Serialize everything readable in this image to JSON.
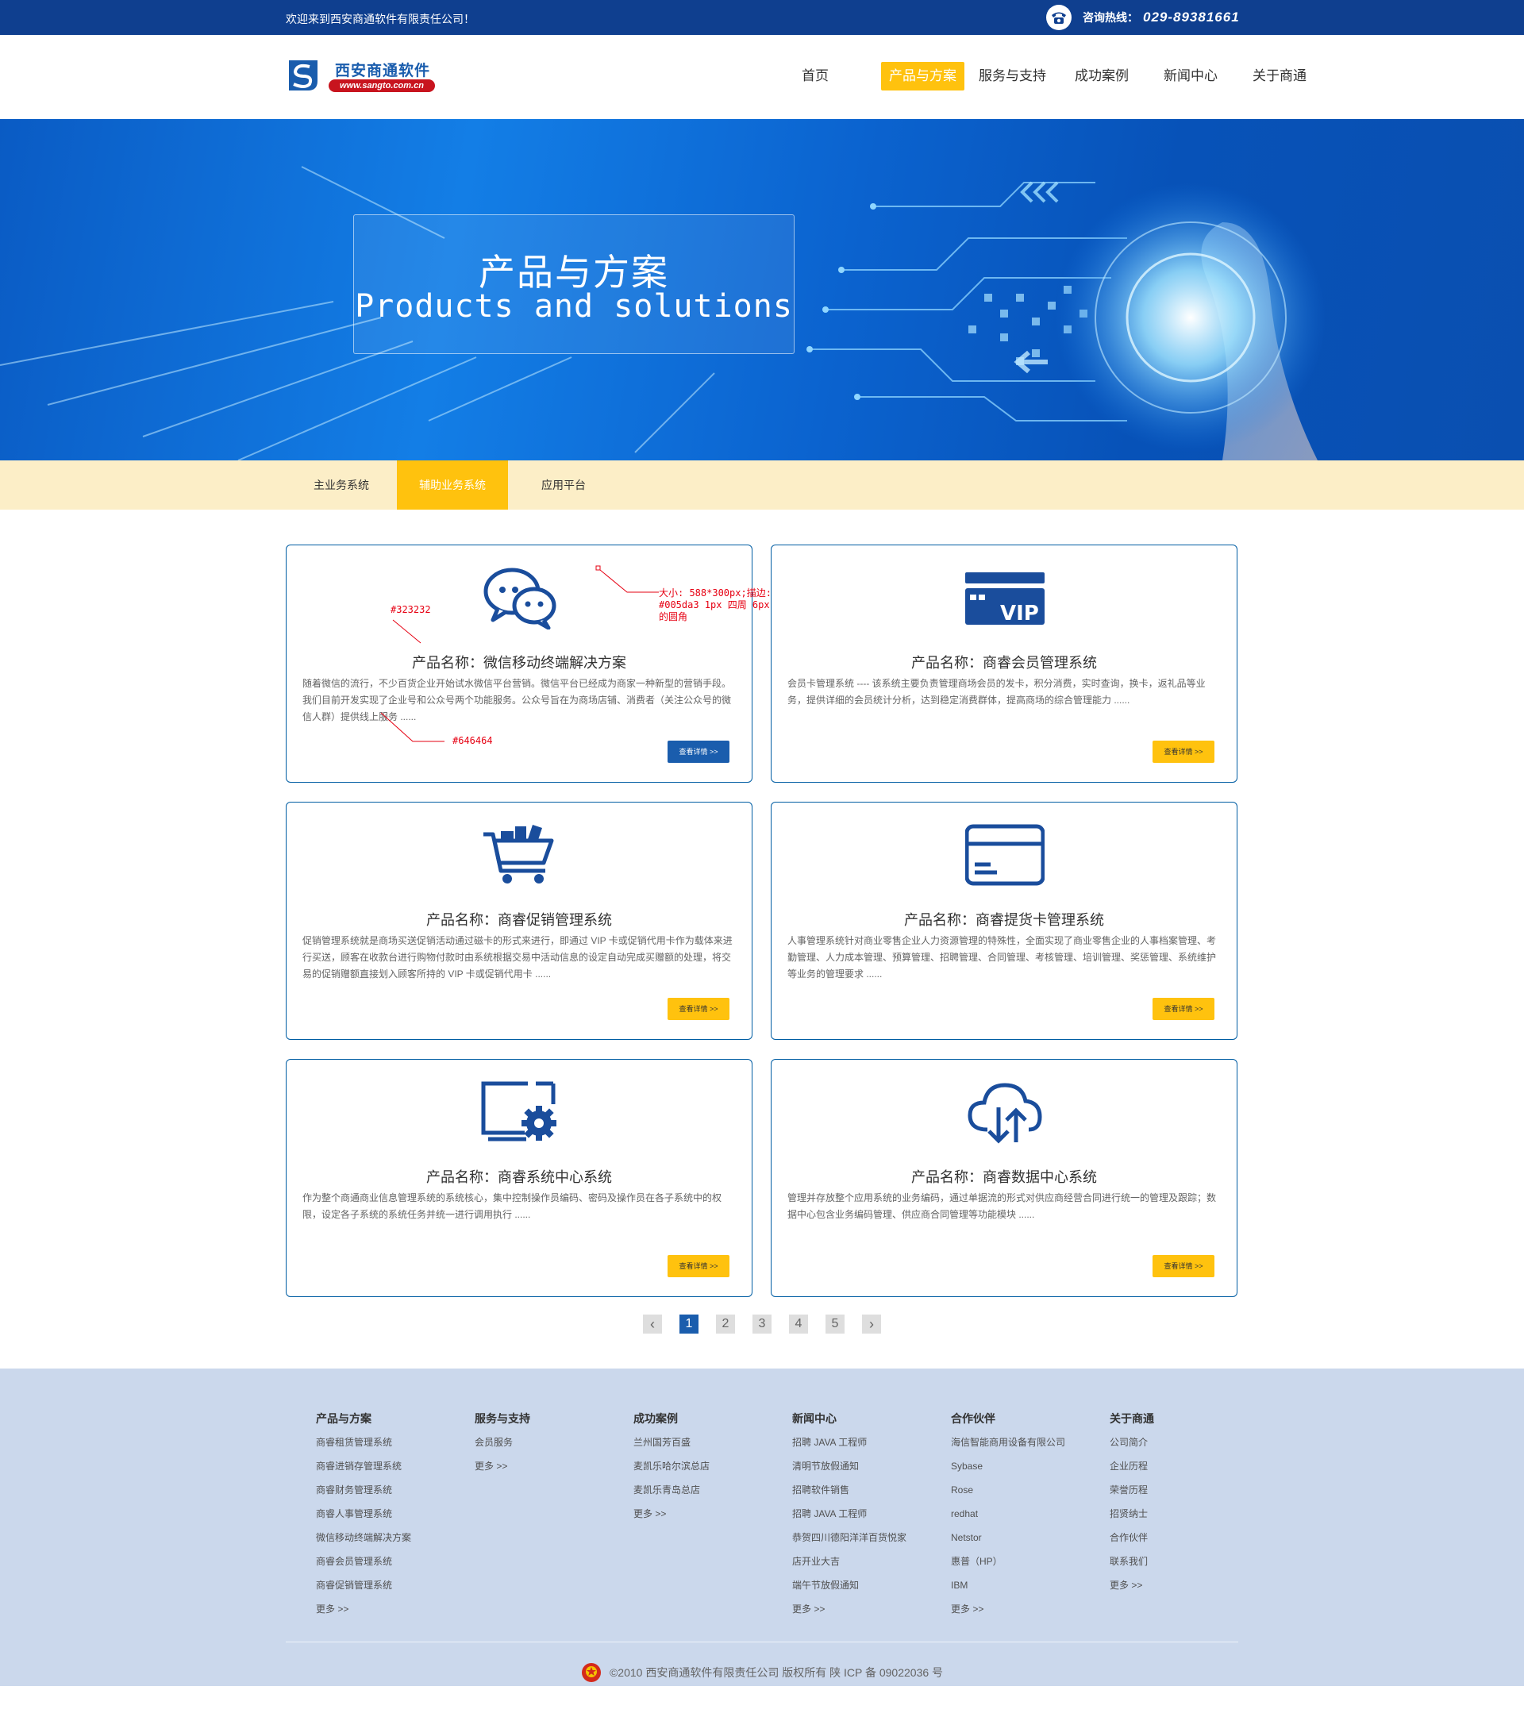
{
  "topbar": {
    "welcome": "欢迎来到西安商通软件有限责任公司！",
    "hotline_label": "咨询热线：",
    "hotline_number": "029-89381661",
    "phone_icon": "phone-icon"
  },
  "header": {
    "logo_name": "西安商通软件",
    "logo_url": "www.sangto.com.cn",
    "nav": [
      "首页",
      "产品与方案",
      "服务与支持",
      "成功案例",
      "新闻中心",
      "关于商通"
    ],
    "nav_active": "产品与方案"
  },
  "banner": {
    "title_cn": "产品与方案",
    "title_en": "Products and solutions"
  },
  "subnav": {
    "tabs": [
      "主业务系统",
      "辅助业务系统",
      "应用平台"
    ],
    "active": "辅助业务系统"
  },
  "products": [
    {
      "icon": "wechat-icon",
      "title": "产品名称：微信移动终端解决方案",
      "desc": "随着微信的流行，不少百货企业开始试水微信平台营销。微信平台已经成为商家一种新型的营销手段。我们目前开发实现了企业号和公众号两个功能服务。公众号旨在为商场店铺、消费者（关注公众号的微信人群）提供线上服务 ......",
      "button": "查看详情 >>"
    },
    {
      "icon": "vip-card-icon",
      "title": "产品名称：商睿会员管理系统",
      "desc": "会员卡管理系统 ---- 该系统主要负责管理商场会员的发卡，积分消费，实时查询，换卡，返礼品等业务，提供详细的会员统计分析，达到稳定消费群体，提高商场的综合管理能力 ......",
      "button": "查看详情 >>"
    },
    {
      "icon": "shopping-cart-icon",
      "title": "产品名称：商睿促销管理系统",
      "desc": "促销管理系统就是商场买送促销活动通过磁卡的形式来进行，即通过 VIP 卡或促销代用卡作为载体来进行买送，顾客在收款台进行购物付款时由系统根据交易中活动信息的设定自动完成买赠额的处理，将交易的促销赠额直接划入顾客所持的 VIP 卡或促销代用卡 ......",
      "button": "查看详情 >>"
    },
    {
      "icon": "credit-card-icon",
      "title": "产品名称：商睿提货卡管理系统",
      "desc": "人事管理系统针对商业零售企业人力资源管理的特殊性，全面实现了商业零售企业的人事档案管理、考勤管理、人力成本管理、预算管理、招聘管理、合同管理、考核管理、培训管理、奖惩管理、系统维护等业务的管理要求 ......",
      "button": "查看详情 >>"
    },
    {
      "icon": "monitor-gear-icon",
      "title": "产品名称：商睿系统中心系统",
      "desc": "作为整个商通商业信息管理系统的系统核心，集中控制操作员编码、密码及操作员在各子系统中的权限，设定各子系统的系统任务并统一进行调用执行 ......",
      "button": "查看详情 >>"
    },
    {
      "icon": "cloud-sync-icon",
      "title": "产品名称：商睿数据中心系统",
      "desc": "管理并存放整个应用系统的业务编码，通过单据流的形式对供应商经营合同进行统一的管理及跟踪；数据中心包含业务编码管理、供应商合同管理等功能模块 ......",
      "button": "查看详情 >>"
    }
  ],
  "annotations": {
    "size_note": "大小: 588*300px;描边: #005da3 1px 四周 6px的圆角",
    "title_color": "#323232",
    "desc_color": "#646464"
  },
  "pagination": {
    "prev": "‹",
    "pages": [
      "1",
      "2",
      "3",
      "4",
      "5"
    ],
    "active": "1",
    "next": "›"
  },
  "footer": {
    "columns": [
      {
        "title": "产品与方案",
        "links": [
          "商睿租赁管理系统",
          "商睿进销存管理系统",
          "商睿财务管理系统",
          "商睿人事管理系统",
          "微信移动终端解决方案",
          "商睿会员管理系统",
          "商睿促销管理系统",
          "更多 >>"
        ]
      },
      {
        "title": "服务与支持",
        "links": [
          "会员服务",
          "更多 >>"
        ]
      },
      {
        "title": "成功案例",
        "links": [
          "兰州国芳百盛",
          "麦凯乐哈尔滨总店",
          "麦凯乐青岛总店",
          "更多 >>"
        ]
      },
      {
        "title": "新闻中心",
        "links": [
          "招聘 JAVA 工程师",
          "清明节放假通知",
          "招聘软件销售",
          "招聘 JAVA 工程师",
          "恭贺四川德阳洋洋百货悦家",
          "店开业大吉",
          "端午节放假通知",
          "更多 >>"
        ]
      },
      {
        "title": "合作伙伴",
        "links": [
          "海信智能商用设备有限公司",
          "Sybase",
          "Rose",
          "redhat",
          "Netstor",
          "惠普（HP）",
          "IBM",
          "更多 >>"
        ]
      },
      {
        "title": "关于商通",
        "links": [
          "公司简介",
          "企业历程",
          "荣誉历程",
          "招贤纳士",
          "合作伙伴",
          "联系我们",
          "更多 >>"
        ]
      }
    ],
    "copyright": "©2010 西安商通软件有限责任公司 版权所有   陕 ICP 备 09022036 号"
  },
  "colors": {
    "brand_blue": "#1a5dad",
    "card_border": "#005da3",
    "accent_yellow": "#ffc20e",
    "topbar_bg": "#0f3f8f",
    "footer_bg": "#cbd8ec"
  }
}
